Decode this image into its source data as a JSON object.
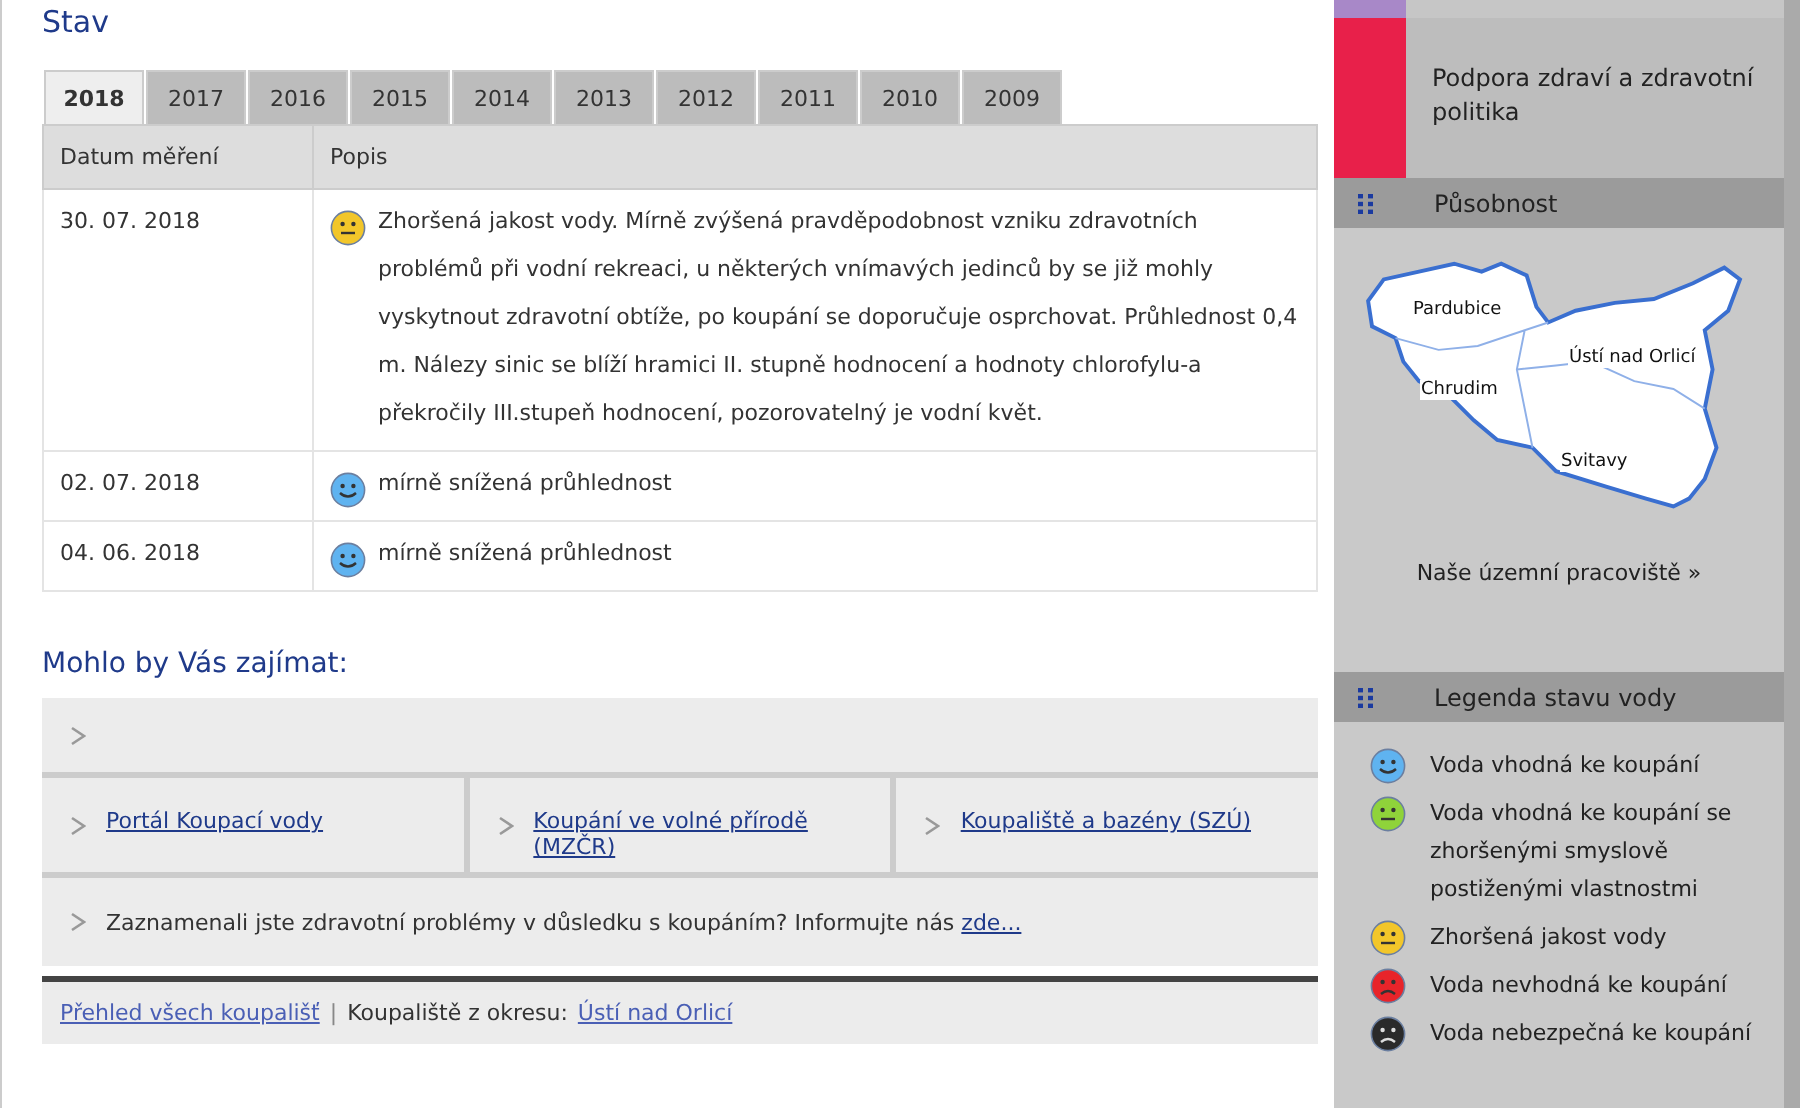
{
  "main": {
    "heading": "Stav",
    "tabs": [
      {
        "label": "2018",
        "selected": true
      },
      {
        "label": "2017",
        "selected": false
      },
      {
        "label": "2016",
        "selected": false
      },
      {
        "label": "2015",
        "selected": false
      },
      {
        "label": "2014",
        "selected": false
      },
      {
        "label": "2013",
        "selected": false
      },
      {
        "label": "2012",
        "selected": false
      },
      {
        "label": "2011",
        "selected": false
      },
      {
        "label": "2010",
        "selected": false
      },
      {
        "label": "2009",
        "selected": false
      }
    ],
    "table": {
      "columns": [
        "Datum měření",
        "Popis"
      ],
      "rows": [
        {
          "date": "30. 07. 2018",
          "kind": "yellow",
          "text": "Zhoršená jakost vody. Mírně zvýšená pravděpodobnost vzniku zdravotních problémů při vodní rekreaci, u některých vnímavých jedinců by se již mohly vyskytnout zdravotní obtíže, po koupání se doporučuje osprchovat. Průhlednost 0,4 m. Nálezy sinic se blíží hramici II. stupně hodnocení a hodnoty chlorofylu-a překročily III.stupeň hodnocení, pozorovatelný je vodní květ."
        },
        {
          "date": "02. 07. 2018",
          "kind": "blue",
          "text": "mírně snížená průhlednost"
        },
        {
          "date": "04. 06. 2018",
          "kind": "blue",
          "text": "mírně snížená průhlednost"
        }
      ]
    },
    "related": {
      "heading": "Mohlo by Vás zajímat:",
      "links": [
        "Portál Koupací vody",
        "Koupání ve volné přírodě (MZČR)",
        "Koupaliště a bazény (SZÚ)"
      ],
      "notice": {
        "text": "Zaznamenali jste zdravotní problémy v důsledku s koupáním? Informujte nás",
        "link": "zde..."
      }
    },
    "footer": {
      "link": "Přehled všech koupališť",
      "separator": "|",
      "label": "Koupaliště z okresu:",
      "district": "Ústí nad Orlicí"
    }
  },
  "sidebar": {
    "category": "Podpora zdraví a zdravotní politika",
    "scope": {
      "title": "Působnost",
      "regions": [
        "Pardubice",
        "Chrudim",
        "Ústí nad Orlicí",
        "Svitavy"
      ],
      "link": "Naše územní pracoviště »"
    },
    "legend": {
      "title": "Legenda stavu vody",
      "items": [
        {
          "kind": "blue",
          "label": "Voda vhodná ke koupání"
        },
        {
          "kind": "green",
          "label": "Voda vhodná ke koupání se zhoršenými smyslově postiženými vlastnostmi"
        },
        {
          "kind": "yellow",
          "label": "Zhoršená jakost vody"
        },
        {
          "kind": "red",
          "label": "Voda nevhodná ke koupání"
        },
        {
          "kind": "black",
          "label": "Voda nebezpečná ke koupání"
        }
      ]
    }
  }
}
